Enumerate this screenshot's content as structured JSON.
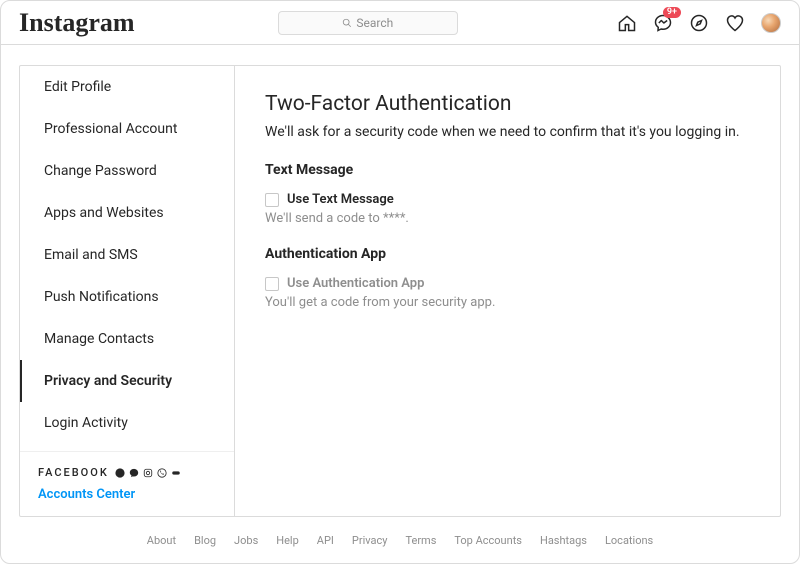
{
  "header": {
    "logo": "Instagram",
    "search_placeholder": "Search",
    "badge": "9+"
  },
  "sidebar": {
    "items": [
      {
        "label": "Edit Profile"
      },
      {
        "label": "Professional Account"
      },
      {
        "label": "Change Password"
      },
      {
        "label": "Apps and Websites"
      },
      {
        "label": "Email and SMS"
      },
      {
        "label": "Push Notifications"
      },
      {
        "label": "Manage Contacts"
      },
      {
        "label": "Privacy and Security"
      },
      {
        "label": "Login Activity"
      }
    ],
    "footer_brand": "FACEBOOK",
    "accounts_center": "Accounts Center"
  },
  "main": {
    "title": "Two-Factor Authentication",
    "subtitle": "We'll ask for a security code when we need to confirm that it's you logging in.",
    "text_message": {
      "heading": "Text Message",
      "option_label": "Use Text Message",
      "description": "We'll send a code to ****."
    },
    "auth_app": {
      "heading": "Authentication App",
      "option_label": "Use Authentication App",
      "description": "You'll get a code from your security app."
    }
  },
  "footer_links": [
    "About",
    "Blog",
    "Jobs",
    "Help",
    "API",
    "Privacy",
    "Terms",
    "Top Accounts",
    "Hashtags",
    "Locations"
  ]
}
